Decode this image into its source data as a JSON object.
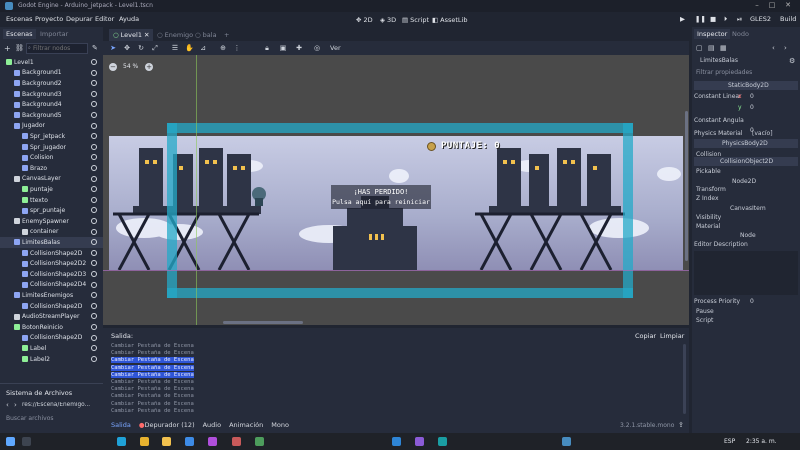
{
  "window": {
    "title": "Godot Engine - Arduino_jetpack - Level1.tscn"
  },
  "menubar": {
    "items": [
      "Escenas",
      "Proyecto",
      "Depurar",
      "Editor",
      "Ayuda"
    ],
    "workspaces": [
      "2D",
      "3D",
      "Script",
      "AssetLib"
    ],
    "renderer": "GLES2",
    "build_label": "Build"
  },
  "scene_dock": {
    "tabs": [
      "Escenas",
      "Importar"
    ],
    "filter_placeholder": "Filtrar nodos",
    "nodes": [
      {
        "label": "Level1",
        "depth": 0,
        "color": "#8eef97"
      },
      {
        "label": "Background1",
        "depth": 1,
        "color": "#8da5f3"
      },
      {
        "label": "Background2",
        "depth": 1,
        "color": "#8da5f3"
      },
      {
        "label": "Background3",
        "depth": 1,
        "color": "#8da5f3"
      },
      {
        "label": "Background4",
        "depth": 1,
        "color": "#8da5f3"
      },
      {
        "label": "Background5",
        "depth": 1,
        "color": "#8da5f3"
      },
      {
        "label": "Jugador",
        "depth": 1,
        "color": "#8da5f3"
      },
      {
        "label": "Spr_jetpack",
        "depth": 2,
        "color": "#8da5f3"
      },
      {
        "label": "Spr_jugador",
        "depth": 2,
        "color": "#8da5f3"
      },
      {
        "label": "Colision",
        "depth": 2,
        "color": "#8da5f3"
      },
      {
        "label": "Brazo",
        "depth": 2,
        "color": "#8da5f3"
      },
      {
        "label": "CanvasLayer",
        "depth": 1,
        "color": "#cfd4dc"
      },
      {
        "label": "puntaje",
        "depth": 2,
        "color": "#8eef97"
      },
      {
        "label": "ttexto",
        "depth": 2,
        "color": "#8eef97"
      },
      {
        "label": "spr_puntaje",
        "depth": 2,
        "color": "#8da5f3"
      },
      {
        "label": "EnemySpawner",
        "depth": 1,
        "color": "#cfd4dc"
      },
      {
        "label": "container",
        "depth": 2,
        "color": "#cfd4dc"
      },
      {
        "label": "LimitesBalas",
        "depth": 1,
        "color": "#8da5f3",
        "selected": true
      },
      {
        "label": "CollisionShape2D",
        "depth": 2,
        "color": "#8da5f3"
      },
      {
        "label": "CollisionShape2D2",
        "depth": 2,
        "color": "#8da5f3"
      },
      {
        "label": "CollisionShape2D3",
        "depth": 2,
        "color": "#8da5f3"
      },
      {
        "label": "CollisionShape2D4",
        "depth": 2,
        "color": "#8da5f3"
      },
      {
        "label": "LimitesEnemigos",
        "depth": 1,
        "color": "#8da5f3"
      },
      {
        "label": "CollisionShape2D",
        "depth": 2,
        "color": "#8da5f3"
      },
      {
        "label": "AudioStreamPlayer",
        "depth": 1,
        "color": "#cfd4dc"
      },
      {
        "label": "BotonReinicio",
        "depth": 1,
        "color": "#8eef97"
      },
      {
        "label": "CollisionShape2D",
        "depth": 2,
        "color": "#8da5f3"
      },
      {
        "label": "Label",
        "depth": 2,
        "color": "#8eef97"
      },
      {
        "label": "Label2",
        "depth": 2,
        "color": "#8eef97"
      }
    ]
  },
  "filesystem_dock": {
    "title": "Sistema de Archivos",
    "path": "res://Escena/Enemigo...",
    "search_placeholder": "Buscar archivos"
  },
  "editor_tabs": [
    {
      "label": "Level1",
      "active": true
    },
    {
      "label": "Enemigo",
      "active": false
    },
    {
      "label": "bala",
      "active": false
    }
  ],
  "toolbar": {
    "view_label": "Ver"
  },
  "viewport": {
    "zoom": "54 %",
    "score_text": "PUNTAJE: 0",
    "lost_title": "¡HAS PERDIDO!",
    "lost_subtitle": "Pulsa aquí para reiniciar"
  },
  "output": {
    "title": "Salida:",
    "copy_label": "Copiar",
    "clear_label": "Limpiar",
    "lines": [
      {
        "text": "Cambiar Pestaña de Escena",
        "hl": false
      },
      {
        "text": "Cambiar Pestaña de Escena",
        "hl": false
      },
      {
        "text": "Cambiar Pestaña de Escena",
        "hl": true
      },
      {
        "text": "Cambiar Pestaña de Escena",
        "hl": true
      },
      {
        "text": "Cambiar Pestaña de Escena",
        "hl": true
      },
      {
        "text": "Cambiar Pestaña de Escena",
        "hl": false
      },
      {
        "text": "Cambiar Pestaña de Escena",
        "hl": false
      },
      {
        "text": "Cambiar Pestaña de Escena",
        "hl": false
      },
      {
        "text": "Cambiar Pestaña de Escena",
        "hl": false
      },
      {
        "text": "Cambiar Pestaña de Escena",
        "hl": false
      }
    ],
    "bottom_tabs": [
      "Salida",
      "Depurador (12)",
      "Audio",
      "Animación",
      "Mono"
    ],
    "version": "3.2.1.stable.mono"
  },
  "inspector": {
    "tabs": [
      "Inspector",
      "Nodo"
    ],
    "node_name": "LimitesBalas",
    "filter_placeholder": "Filtrar propiedades",
    "class_name": "StaticBody2D",
    "constant_linear_label": "Constant Linear",
    "x_label": "x",
    "x_value": "0",
    "y_label": "y",
    "y_value": "0",
    "constant_angular_label": "Constant Angula",
    "constant_angular_value": "0",
    "physics_material_label": "Physics Material",
    "physics_material_value": "[vacío]",
    "physics_body_label": "PhysicsBody2D",
    "collision_label": "Collision",
    "collision_object_label": "CollisionObject2D",
    "pickable_label": "Pickable",
    "node2d_label": "Node2D",
    "transform_label": "Transform",
    "zindex_label": "Z Index",
    "canvasitem_label": "CanvasItem",
    "visibility_label": "Visibility",
    "material_label": "Material",
    "node_label": "Node",
    "editor_description_label": "Editor Description",
    "process_priority_label": "Process Priority",
    "process_priority_value": "0",
    "pause_label": "Pause",
    "script_label": "Script"
  },
  "taskbar": {
    "language": "ESP",
    "time": "2:35 a. m."
  }
}
